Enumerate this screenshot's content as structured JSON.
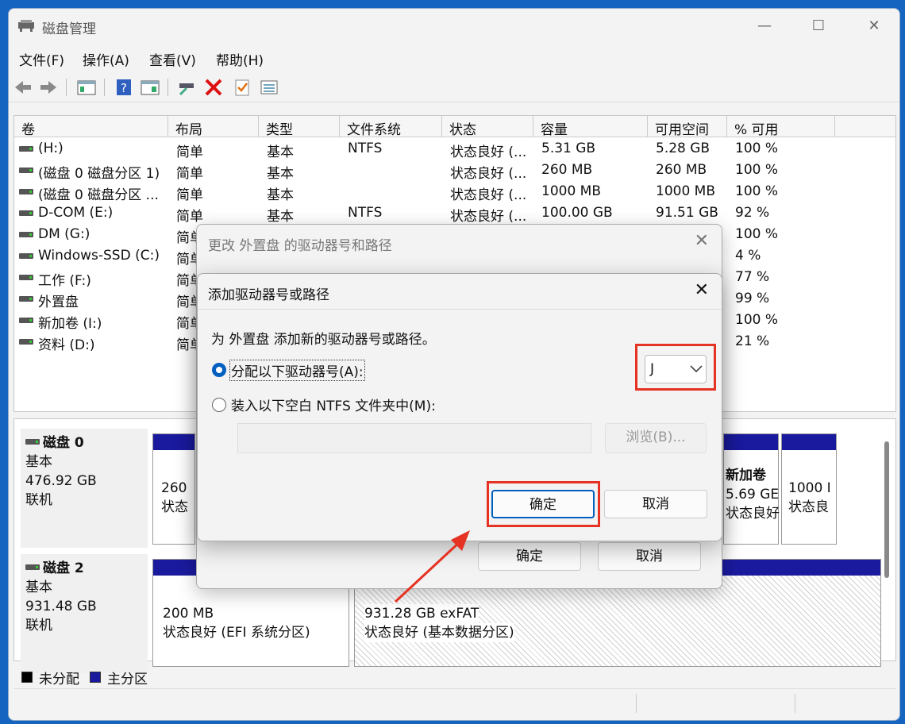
{
  "window": {
    "title": "磁盘管理",
    "min": "—",
    "max": "☐",
    "close": "✕"
  },
  "menu": [
    "文件(F)",
    "操作(A)",
    "查看(V)",
    "帮助(H)"
  ],
  "columns": [
    "卷",
    "布局",
    "类型",
    "文件系统",
    "状态",
    "容量",
    "可用空间",
    "% 可用"
  ],
  "volumes": [
    {
      "name": "(H:)",
      "layout": "简单",
      "type": "基本",
      "fs": "NTFS",
      "status": "状态良好 (...",
      "cap": "5.31 GB",
      "free": "5.28 GB",
      "pct": "100 %"
    },
    {
      "name": "(磁盘 0 磁盘分区 1)",
      "layout": "简单",
      "type": "基本",
      "fs": "",
      "status": "状态良好 (...",
      "cap": "260 MB",
      "free": "260 MB",
      "pct": "100 %"
    },
    {
      "name": "(磁盘 0 磁盘分区 ...",
      "layout": "简单",
      "type": "基本",
      "fs": "",
      "status": "状态良好 (...",
      "cap": "1000 MB",
      "free": "1000 MB",
      "pct": "100 %"
    },
    {
      "name": "D-COM (E:)",
      "layout": "简单",
      "type": "基本",
      "fs": "NTFS",
      "status": "状态良好 (...",
      "cap": "100.00 GB",
      "free": "91.51 GB",
      "pct": "92 %"
    },
    {
      "name": "DM (G:)",
      "layout": "简单",
      "type": "",
      "fs": "",
      "status": "",
      "cap": "",
      "free": "",
      "pct": "100 %"
    },
    {
      "name": "Windows-SSD (C:)",
      "layout": "简单",
      "type": "",
      "fs": "",
      "status": "",
      "cap": "",
      "free": "",
      "pct": "4 %"
    },
    {
      "name": "工作 (F:)",
      "layout": "简单",
      "type": "",
      "fs": "",
      "status": "",
      "cap": "",
      "free": "",
      "pct": "77 %"
    },
    {
      "name": "外置盘",
      "layout": "简单",
      "type": "",
      "fs": "",
      "status": "",
      "cap": "",
      "free": "",
      "pct": "99 %"
    },
    {
      "name": "新加卷 (I:)",
      "layout": "简单",
      "type": "",
      "fs": "",
      "status": "",
      "cap": "",
      "free": "",
      "pct": "100 %"
    },
    {
      "name": "资料 (D:)",
      "layout": "简单",
      "type": "",
      "fs": "",
      "status": "",
      "cap": "",
      "free": "",
      "pct": "21 %"
    }
  ],
  "disk0": {
    "name": "磁盘 0",
    "type": "基本",
    "size": "476.92 GB",
    "state": "联机",
    "p1a": "260",
    "p1b": "状态",
    "p2a": "新加卷",
    "p2b": "5.69 GE",
    "p2c": "状态良好",
    "p3a": "1000 I",
    "p3b": "状态良"
  },
  "disk2": {
    "name": "磁盘 2",
    "type": "基本",
    "size": "931.48 GB",
    "state": "联机",
    "p1a": "200 MB",
    "p1b": "状态良好 (EFI 系统分区)",
    "p2a": "931.28 GB exFAT",
    "p2b": "状态良好 (基本数据分区)"
  },
  "legend": {
    "unalloc": "未分配",
    "primary": "主分区"
  },
  "dialog1": {
    "title": "更改 外置盘 的驱动器号和路径",
    "ok": "确定",
    "cancel": "取消"
  },
  "dialog2": {
    "title": "添加驱动器号或路径",
    "desc": "为 外置盘 添加新的驱动器号或路径。",
    "opt1": "分配以下驱动器号(A):",
    "opt2": "装入以下空白 NTFS 文件夹中(M):",
    "drive": "J",
    "browse": "浏览(B)...",
    "ok": "确定",
    "cancel": "取消"
  }
}
